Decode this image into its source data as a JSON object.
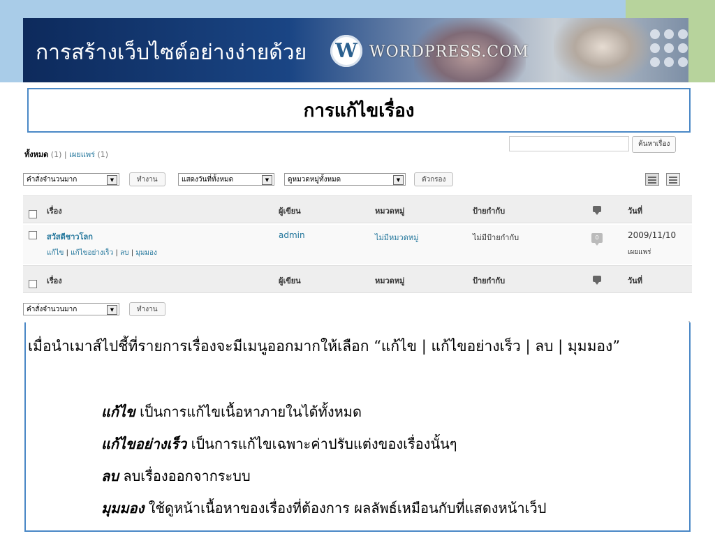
{
  "header": {
    "title": "การสร้างเว็บไซต์อย่างง่ายด้วย",
    "logo_text": "WORDPRESS.COM"
  },
  "section_title": "การแก้ไขเรื่อง",
  "wp": {
    "subsubsub": {
      "all_label": "ทั้งหมด",
      "all_count": "(1)",
      "separator": "|",
      "published_label": "เผยแพร่",
      "published_count": "(1)"
    },
    "search_button": "ค้นหาเรื่อง",
    "bulk_action_select": "คำสั่งจำนวนมาก",
    "apply_button": "ทำงาน",
    "date_filter_select": "แสดงวันที่ทั้งหมด",
    "category_filter_select": "ดูหมวดหมู่ทั้งหมด",
    "filter_button": "ตัวกรอง",
    "columns": {
      "title": "เรื่อง",
      "author": "ผู้เขียน",
      "categories": "หมวดหมู่",
      "tags": "ป้ายกำกับ",
      "date": "วันที่"
    },
    "rows": [
      {
        "title": "สวัสดีชาวโลก",
        "actions": [
          "แก้ไข",
          "แก้ไขอย่างเร็ว",
          "ลบ",
          "มุมมอง"
        ],
        "action_separator": "|",
        "author": "admin",
        "category": "ไม่มีหมวดหมู่",
        "tags": "ไม่มีป้ายกำกับ",
        "comments": "0",
        "date": "2009/11/10",
        "status": "เผยแพร่"
      }
    ],
    "bottom_bulk_action_select": "คำสั่งจำนวนมาก",
    "bottom_apply_button": "ทำงาน"
  },
  "explanation": {
    "intro": "เมื่อนำเมาส์ไปชี้ที่รายการเรื่องจะมีเมนูออกมากให้เลือก “แก้ไข | แก้ไขอย่างเร็ว | ลบ | มุมมอง”",
    "items": [
      {
        "term": "แก้ไข",
        "desc": "เป็นการแก้ไขเนื้อหาภายในได้ทั้งหมด"
      },
      {
        "term": "แก้ไขอย่างเร็ว",
        "desc": "เป็นการแก้ไขเฉพาะค่าปรับแต่งของเรื่องนั้นๆ"
      },
      {
        "term": "ลบ",
        "desc": "ลบเรื่องออกจากระบบ"
      },
      {
        "term": "มุมมอง",
        "desc": "ใช้ดูหน้าเนื้อหาของเรื่องที่ต้องการ ผลลัพธ์เหมือนกับที่แสดงหน้าเว็ป"
      }
    ]
  },
  "colors": {
    "accent_blue": "#4a88c6",
    "link": "#21759b",
    "deco_blue": "#a9cce8",
    "deco_green": "#b7d39c"
  }
}
